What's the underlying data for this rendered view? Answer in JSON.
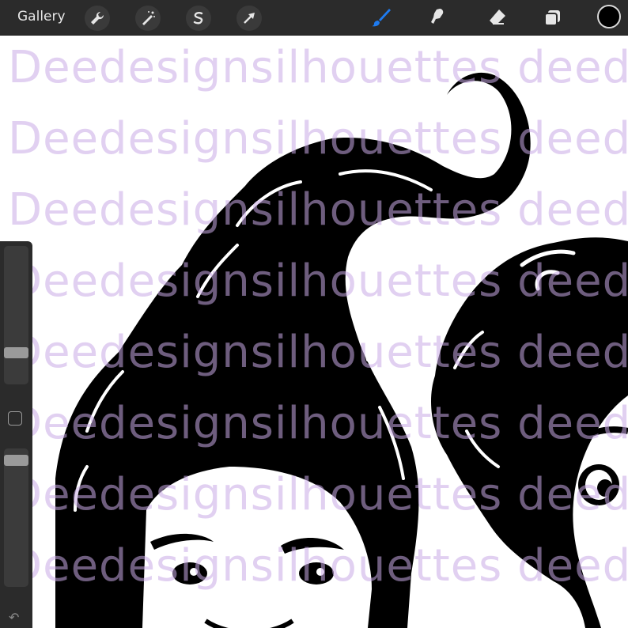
{
  "toolbar": {
    "gallery_label": "Gallery",
    "left_tools": [
      "wrench-icon",
      "magic-wand-icon",
      "selection-icon",
      "transform-arrow-icon"
    ],
    "right_tools": [
      "brush-icon",
      "smudge-icon",
      "eraser-icon",
      "layers-icon"
    ],
    "active_tool": "brush-icon",
    "active_color": "#1e7bf0",
    "current_color": "#000000"
  },
  "canvas": {
    "watermark_lines": [
      "Deedesignsilhouettes deedesign",
      "Deedesignsilhouettes deedesign",
      "Deedesignsilhouettes deedesign",
      "Deedesignsilhouettes deedesign",
      "Deedesignsilhouettes deedesign",
      "Deedesignsilhouettes deedesign",
      "Deedesignsilhouettes deedesign",
      "Deedesignsilhouettes deedesign"
    ],
    "watermark_color": "#d8c4ee"
  },
  "sidebar": {
    "brush_size_level": 0.25,
    "opacity_level": 0.9,
    "undo_icon": "undo-icon"
  }
}
